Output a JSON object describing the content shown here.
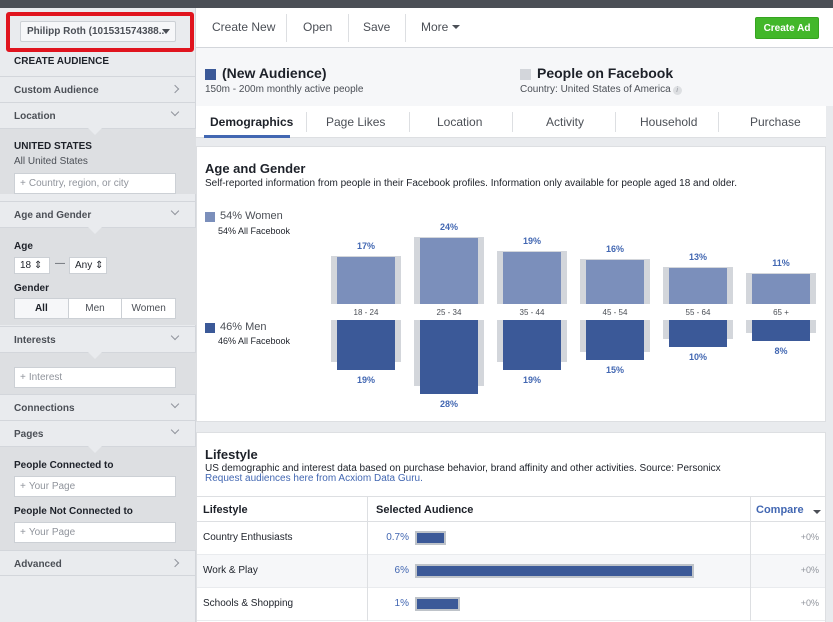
{
  "account": {
    "label": "Philipp Roth (101531574388.."
  },
  "sidebar": {
    "create_title": "CREATE AUDIENCE",
    "custom_audience": "Custom Audience",
    "location": {
      "label": "Location",
      "country": "UNITED STATES",
      "scope": "All United States",
      "placeholder": "Country, region, or city"
    },
    "age_gender": {
      "label": "Age and Gender",
      "age_label": "Age",
      "age_min": "18",
      "age_max": "Any",
      "gender_label": "Gender",
      "gender_options": [
        "All",
        "Men",
        "Women"
      ],
      "gender_selected": "All"
    },
    "interests": {
      "label": "Interests",
      "placeholder": "Interest"
    },
    "connections": "Connections",
    "pages": {
      "label": "Pages",
      "connected_label": "People Connected to",
      "connected_placeholder": "Your Page",
      "not_connected_label": "People Not Connected to",
      "not_connected_placeholder": "Your Page"
    },
    "advanced": "Advanced"
  },
  "toolbar": {
    "create_new": "Create New",
    "open": "Open",
    "save": "Save",
    "more": "More",
    "create_ad": "Create Ad"
  },
  "audience": {
    "left_title": "(New Audience)",
    "left_sub": "150m - 200m monthly active people",
    "right_title": "People on Facebook",
    "right_sub": "Country: United States of America",
    "left_color": "#3b5998",
    "right_color": "#d3d6db"
  },
  "tabs": [
    "Demographics",
    "Page Likes",
    "Location",
    "Activity",
    "Household",
    "Purchase"
  ],
  "age_gender_card": {
    "title": "Age and Gender",
    "subtitle": "Self-reported information from people in their Facebook profiles. Information only available for people aged 18 and older.",
    "women_label": "54% Women",
    "women_sub": "54% All Facebook",
    "men_label": "46% Men",
    "men_sub": "46% All Facebook",
    "women_color": "#7b8fbb",
    "men_color": "#3b5998"
  },
  "chart_data": {
    "type": "bar",
    "categories": [
      "18 - 24",
      "25 - 34",
      "35 - 44",
      "45 - 54",
      "55 - 64",
      "65 +"
    ],
    "series": [
      {
        "name": "Women",
        "values": [
          17,
          24,
          19,
          16,
          13,
          11
        ],
        "labels": [
          "17%",
          "24%",
          "19%",
          "16%",
          "13%",
          "11%"
        ]
      },
      {
        "name": "Men",
        "values": [
          19,
          28,
          19,
          15,
          10,
          8
        ],
        "labels": [
          "19%",
          "28%",
          "19%",
          "15%",
          "10%",
          "8%"
        ]
      }
    ]
  },
  "lifestyle": {
    "title": "Lifestyle",
    "subtitle": "US demographic and interest data based on purchase behavior, brand affinity and other activities. Source: Personicx",
    "link": "Request audiences here from Acxiom Data Guru.",
    "col_lifestyle": "Lifestyle",
    "col_selected": "Selected Audience",
    "col_compare": "Compare",
    "rows": [
      {
        "name": "Country Enthusiasts",
        "value": "0.7%",
        "fill": 0.11,
        "compare": "+0%"
      },
      {
        "name": "Work & Play",
        "value": "6%",
        "fill": 0.99,
        "compare": "+0%"
      },
      {
        "name": "Schools & Shopping",
        "value": "1%",
        "fill": 0.16,
        "compare": "+0%"
      }
    ]
  }
}
